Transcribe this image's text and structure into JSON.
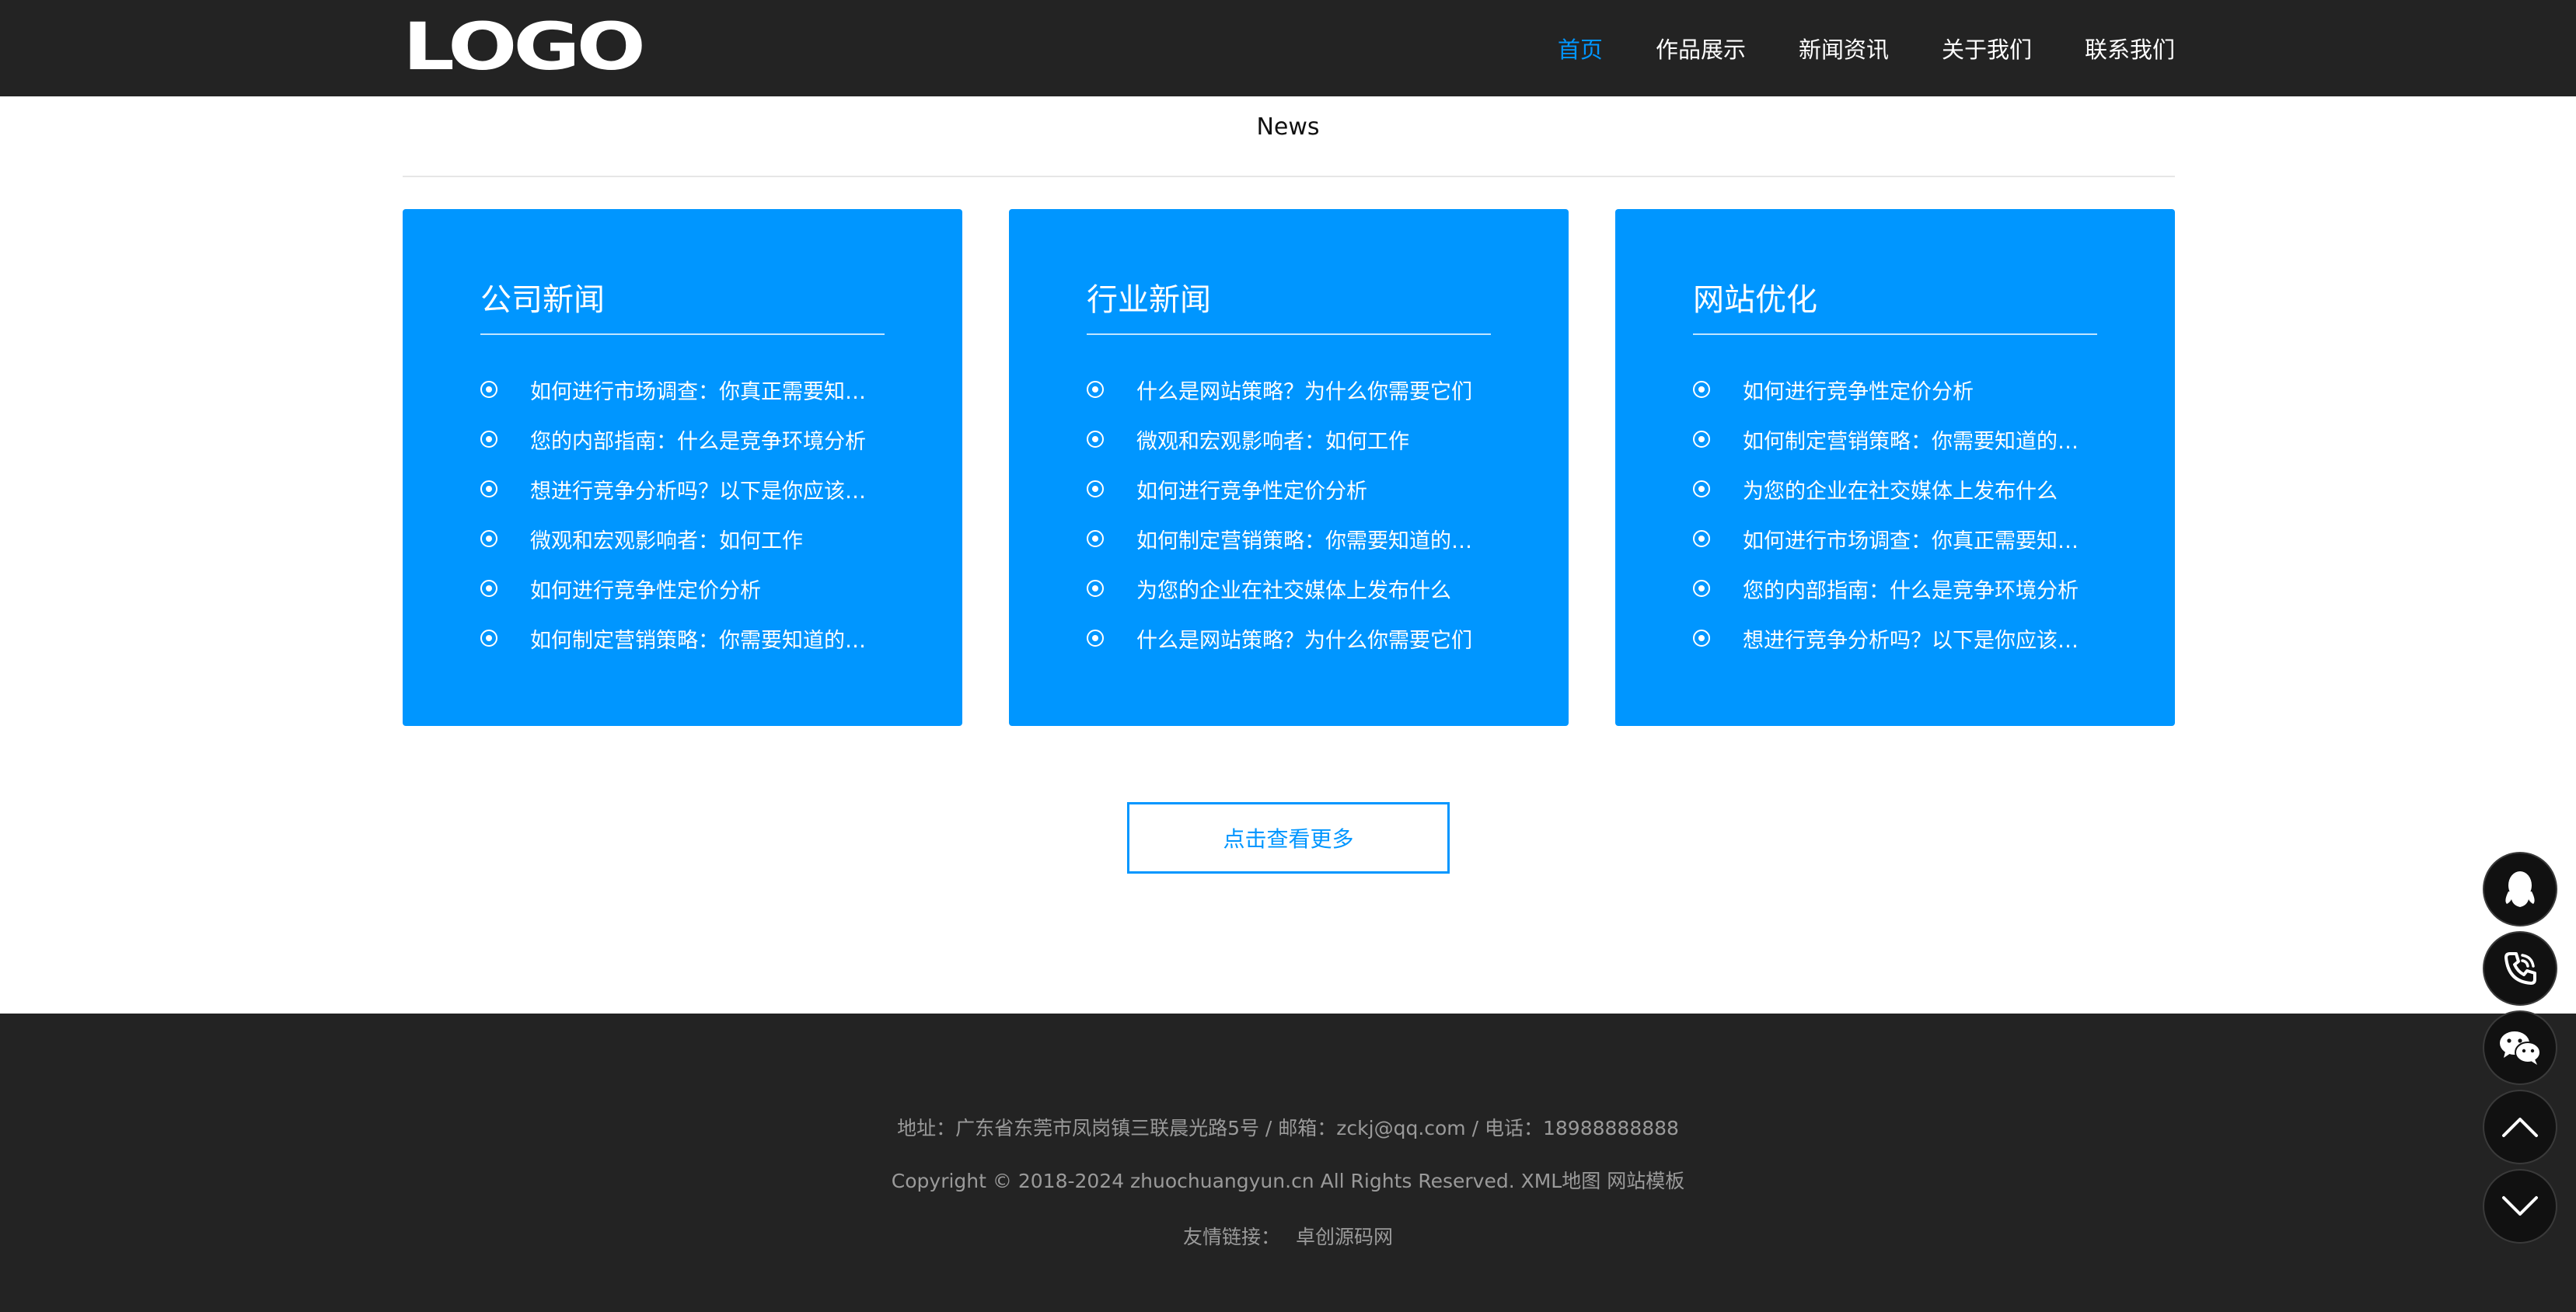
{
  "header": {
    "logo": "LOGO",
    "nav": [
      "首页",
      "作品展示",
      "新闻资讯",
      "关于我们",
      "联系我们"
    ],
    "active_index": 0
  },
  "section": {
    "title": "News"
  },
  "cards": [
    {
      "title": "公司新闻",
      "items": [
        "如何进行市场调查：你真正需要知道的内容",
        "您的内部指南：什么是竞争环境分析",
        "想进行竞争分析吗？以下是你应该知道的",
        "微观和宏观影响者：如何工作",
        "如何进行竞争性定价分析",
        "如何制定营销策略：你需要知道的一切"
      ]
    },
    {
      "title": "行业新闻",
      "items": [
        "什么是网站策略？为什么你需要它们",
        "微观和宏观影响者：如何工作",
        "如何进行竞争性定价分析",
        "如何制定营销策略：你需要知道的一切",
        "为您的企业在社交媒体上发布什么",
        "什么是网站策略？为什么你需要它们"
      ]
    },
    {
      "title": "网站优化",
      "items": [
        "如何进行竞争性定价分析",
        "如何制定营销策略：你需要知道的一切",
        "为您的企业在社交媒体上发布什么",
        "如何进行市场调查：你真正需要知道的内容",
        "您的内部指南：什么是竞争环境分析",
        "想进行竞争分析吗？以下是你应该知道的"
      ]
    }
  ],
  "more_button": "点击查看更多",
  "footer": {
    "address": "地址：广东省东莞市凤岗镇三联晨光路5号 / 邮箱：zckj@qq.com / 电话：18988888888",
    "copyright": "Copyright © 2018-2024 zhuochuangyun.cn All Rights Reserved.",
    "sitemap": "XML地图",
    "template": "网站模板",
    "links_label": "友情链接：",
    "link": "卓创源码网"
  },
  "float_buttons": {
    "qq": "qq-icon",
    "phone": "phone-icon",
    "wechat": "wechat-icon",
    "up": "arrow-up-icon",
    "down": "arrow-down-icon"
  }
}
